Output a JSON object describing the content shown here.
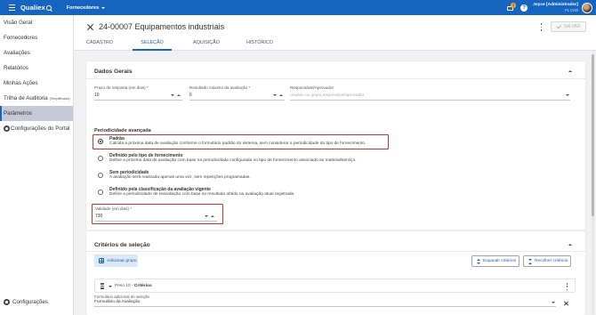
{
  "topbar": {
    "logo": "Qualiex",
    "module": "Fornecedores",
    "notification_count": "1",
    "help_label": "?",
    "user_name": "Joyce [Administrador]",
    "user_company": "FL CAD"
  },
  "sidebar": {
    "items": [
      {
        "label": "Visão Geral"
      },
      {
        "label": "Fornecedores"
      },
      {
        "label": "Avaliações"
      },
      {
        "label": "Relatórios"
      },
      {
        "label": "Minhas Ações"
      },
      {
        "label": "Trilha de Auditoria",
        "note": "(Simplificada)"
      },
      {
        "label": "Parâmetros",
        "active": true
      },
      {
        "label": "Configurações do Portal",
        "icon": "gear-icon"
      }
    ],
    "bottom_item": {
      "label": "Configurações",
      "icon": "gear-icon"
    }
  },
  "header": {
    "title": "24-00007 Equipamentos industriais",
    "save_label": "SALVAR",
    "tabs": [
      {
        "label": "CADASTRO"
      },
      {
        "label": "SELEÇÃO",
        "active": true
      },
      {
        "label": "AQUISIÇÃO"
      },
      {
        "label": "HISTÓRICO"
      }
    ]
  },
  "dados_gerais": {
    "title": "Dados Gerais",
    "prazo": {
      "label": "Prazo de resposta (em dias) *",
      "value": "10"
    },
    "resultado": {
      "label": "Resultado máximo da avaliação *",
      "value": "6"
    },
    "responsavel": {
      "label": "Responsável/Aprovador",
      "placeholder": "Usuário ou grupo responsável/aprovador"
    },
    "periodicidade_label": "Periodicidade avançada",
    "options": [
      {
        "title": "Padrão",
        "desc": "Calcula a próxima data de avaliação conforme o formulário padrão do sistema, sem considerar a periodicidade do tipo de fornecimento.",
        "checked": true
      },
      {
        "title": "Definido pelo tipo de fornecimento",
        "desc": "Define a próxima data de avaliação com base na periodicidade configurada no tipo de fornecimento associado ao material/serviço.",
        "checked": false
      },
      {
        "title": "Sem periodicidade",
        "desc": "A avaliação será realizada apenas uma vez, sem repetições programadas.",
        "checked": false
      },
      {
        "title": "Definido pela classificação da avaliação vigente",
        "desc": "Define a periodicidade de reavaliação com base no resultado obtido na avaliação atual registrada.",
        "checked": false
      }
    ],
    "validade": {
      "label": "Validade (em dias) *",
      "value": "730"
    }
  },
  "criterios": {
    "title": "Critérios de seleção",
    "add_group_label": "Adicionar grupo",
    "expand_label": "Expandir critérios",
    "collapse_label": "Recolher critérios",
    "row": {
      "peso": "Peso 10",
      "separator": "-",
      "name": "Critérios"
    },
    "formulario": {
      "label": "Formulário adicional de seleção",
      "value": "Formulário da Avaliação"
    }
  },
  "colors": {
    "primary": "#1565c0",
    "highlight_border": "#d32f2f",
    "active_nav_bg": "#c5c9d6",
    "badge": "#f9a825"
  }
}
